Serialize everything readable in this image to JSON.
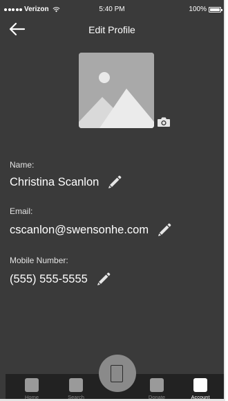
{
  "status_bar": {
    "carrier": "Verizon",
    "time": "5:40 PM",
    "battery": "100%"
  },
  "header": {
    "title": "Edit Profile",
    "back_icon": "arrow-left-icon"
  },
  "profile": {
    "photo_icon": "image-placeholder-icon",
    "camera_icon": "camera-icon",
    "fields": [
      {
        "label": "Name:",
        "value": "Christina Scanlon",
        "edit_icon": "pencil-icon"
      },
      {
        "label": "Email:",
        "value": "cscanlon@swensonhe.com",
        "edit_icon": "pencil-icon"
      },
      {
        "label": "Mobile Number:",
        "value": "(555) 555-5555",
        "edit_icon": "pencil-icon"
      }
    ]
  },
  "bottom_nav": {
    "items": [
      {
        "label": "Home",
        "active": false
      },
      {
        "label": "Search",
        "active": false
      },
      {
        "label": "Donate",
        "active": false
      },
      {
        "label": "Account",
        "active": true
      }
    ],
    "center_action_icon": "phone-outline-icon"
  },
  "colors": {
    "background": "#3a3a3a",
    "text": "#ffffff",
    "nav_background": "#222222",
    "placeholder": "#a9a9a9"
  }
}
